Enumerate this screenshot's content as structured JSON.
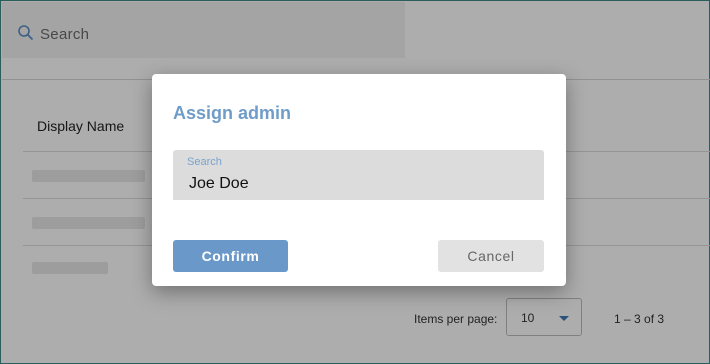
{
  "search": {
    "placeholder": "Search"
  },
  "table": {
    "column_header": "Display Name"
  },
  "pagination": {
    "items_per_page_label": "Items per page:",
    "items_per_page_value": "10",
    "range": "1 – 3 of 3"
  },
  "dialog": {
    "title": "Assign admin",
    "field_label": "Search",
    "field_value": "Joe Doe",
    "confirm_label": "Confirm",
    "cancel_label": "Cancel"
  },
  "colors": {
    "accent": "#6a98c9",
    "title": "#6f9cc9",
    "border": "#3c8c86"
  }
}
